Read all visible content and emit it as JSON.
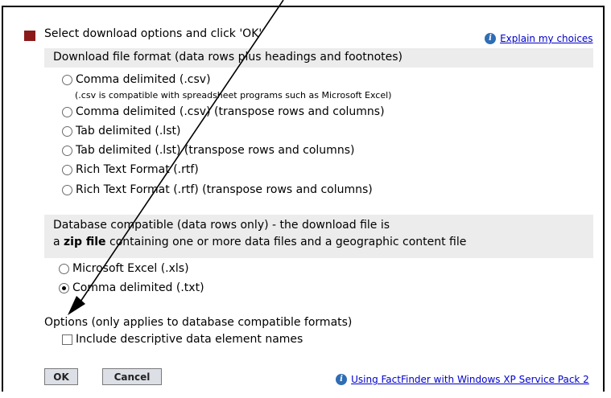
{
  "header": {
    "instruction": "Select download options and click 'OK'",
    "explain_link": "Explain my choices",
    "bullet_color": "#8b1a1a"
  },
  "section1": {
    "title": "Download file format (data rows plus headings and footnotes)",
    "options": [
      {
        "label": "Comma delimited (.csv)",
        "selected": false
      },
      {
        "label": "Comma delimited (.csv) (transpose rows and columns)",
        "selected": false
      },
      {
        "label": "Tab delimited (.lst)",
        "selected": false
      },
      {
        "label": "Tab delimited (.lst) (transpose rows and columns)",
        "selected": false
      },
      {
        "label": "Rich Text Format (.rtf)",
        "selected": false
      },
      {
        "label": "Rich Text Format (.rtf) (transpose rows and columns)",
        "selected": false
      }
    ],
    "csv_note": "(.csv is compatible with spreadsheet programs such as Microsoft Excel)"
  },
  "section2": {
    "line1": "Database compatible (data rows only) - the download file is",
    "line2_prefix": "a ",
    "line2_bold": "zip file",
    "line2_suffix": " containing one or more data files and a geographic content file",
    "options": [
      {
        "label": "Microsoft Excel (.xls)",
        "selected": false
      },
      {
        "label": "Comma delimited (.txt)",
        "selected": true
      }
    ]
  },
  "options_section": {
    "title": "Options (only applies to database compatible formats)",
    "checkbox_label": "Include descriptive data element names",
    "checked": false
  },
  "buttons": {
    "ok": "OK",
    "cancel": "Cancel"
  },
  "footer_link": "Using FactFinder with Windows XP Service Pack 2",
  "accent_link_color": "#0000cc",
  "info_icon_color": "#2f6db5"
}
